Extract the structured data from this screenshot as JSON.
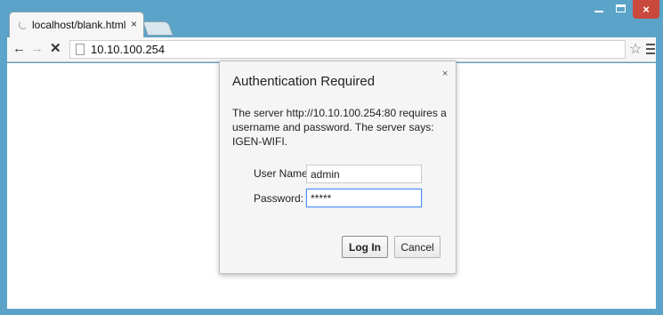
{
  "browser": {
    "tab": {
      "title": "localhost/blank.html",
      "close": "×"
    },
    "window_controls": {
      "close": "×"
    },
    "toolbar": {
      "back": "←",
      "forward": "→",
      "stop": "✕",
      "url": "10.10.100.254",
      "star": "☆"
    }
  },
  "dialog": {
    "title": "Authentication Required",
    "close": "×",
    "message": "The server http://10.10.100.254:80 requires a username and password. The server says: IGEN-WIFI.",
    "username_label": "User Name:",
    "username_value": "admin",
    "password_label": "Password:",
    "password_value": "*****",
    "login_label": "Log In",
    "cancel_label": "Cancel"
  },
  "icons": [
    "spinner-icon",
    "back-arrow-icon",
    "forward-arrow-icon",
    "stop-icon",
    "page-icon",
    "star-icon",
    "menu-icon",
    "minimize-icon",
    "maximize-icon",
    "close-icon"
  ]
}
